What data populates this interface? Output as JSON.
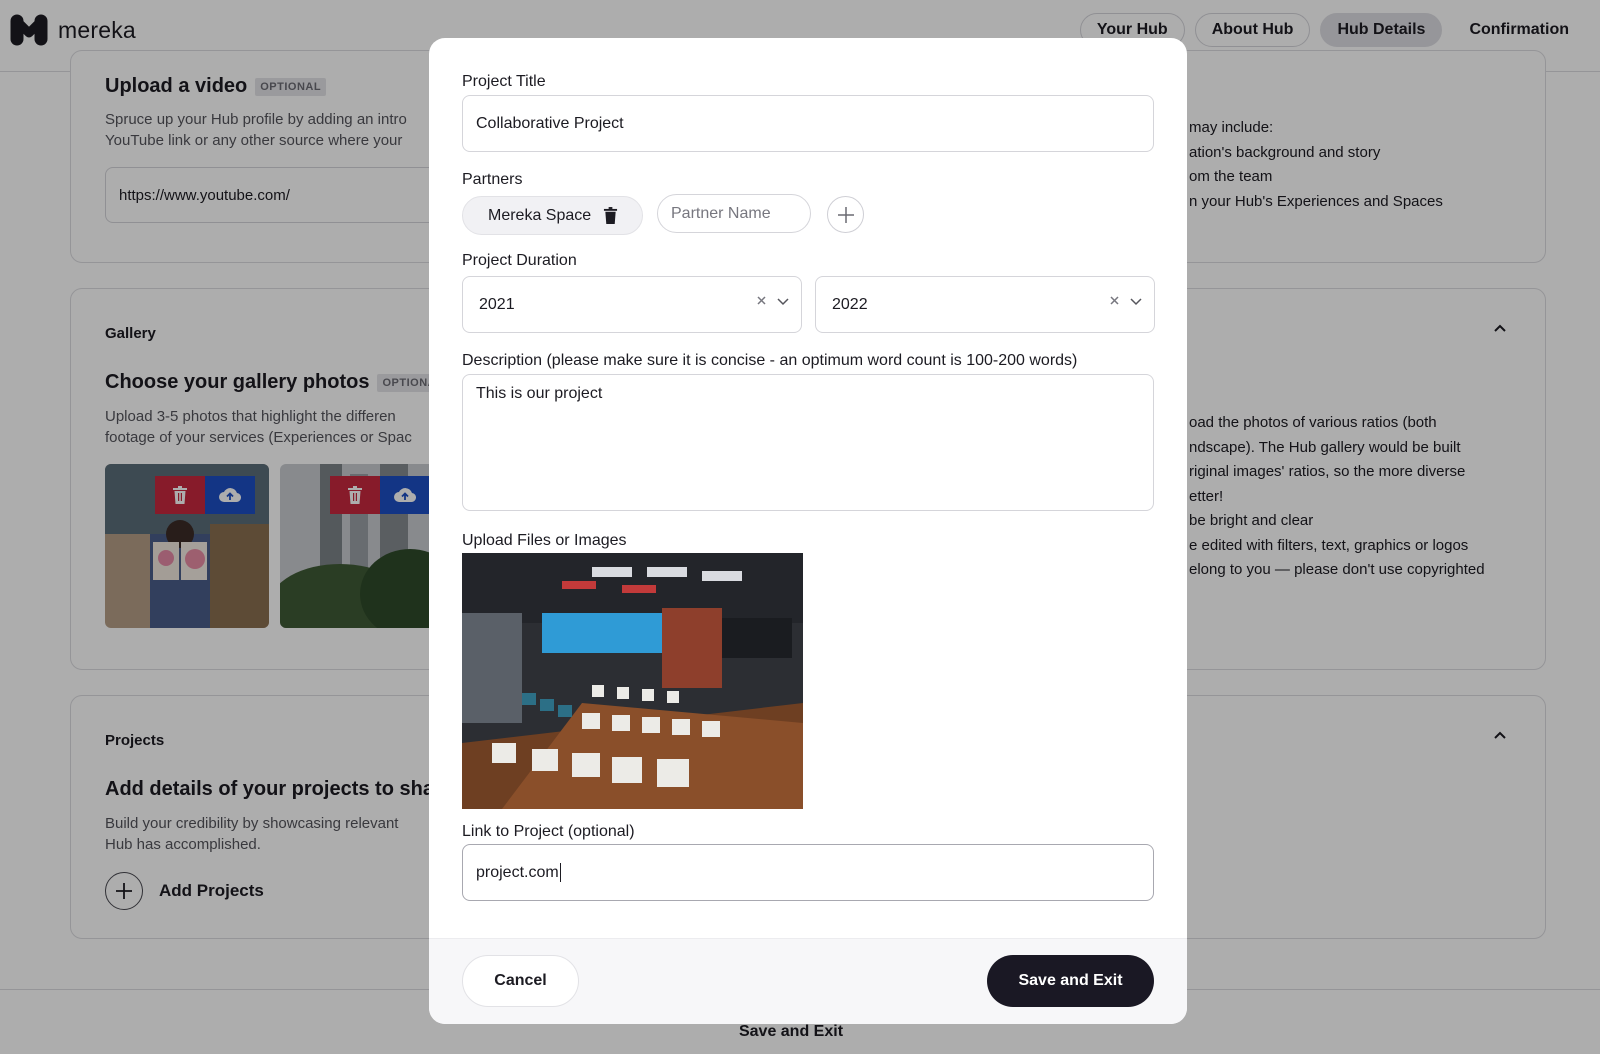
{
  "app": {
    "brand": "mereka"
  },
  "steps": [
    {
      "label": "Your Hub"
    },
    {
      "label": "About Hub"
    },
    {
      "label": "Hub Details"
    },
    {
      "label": "Confirmation"
    }
  ],
  "video_section": {
    "heading": "Upload a video",
    "badge": "OPTIONAL",
    "desc_line1": "Spruce up your Hub profile by adding an intro",
    "desc_line2": "YouTube link or any other source where your",
    "url_value": "https://www.youtube.com/",
    "right_list": [
      "may include:",
      "ation's background and story",
      "om the team",
      "n your Hub's Experiences and Spaces"
    ]
  },
  "gallery_section": {
    "label": "Gallery",
    "heading": "Choose your gallery photos",
    "badge": "OPTIONA",
    "desc_line1": "Upload 3-5 photos that highlight the differen",
    "desc_line2": "footage of your services (Experiences or Spac",
    "right_list": [
      "oad the photos of various ratios (both",
      "ndscape). The Hub gallery would be built",
      "riginal images' ratios, so the more diverse",
      "etter!",
      "be bright and clear",
      "e edited with filters, text, graphics or logos",
      "elong to you — please don't use copyrighted"
    ]
  },
  "projects_section": {
    "label": "Projects",
    "heading": "Add details of your projects to shar",
    "desc_line1": "Build your credibility by showcasing relevant",
    "desc_line2": "Hub has accomplished.",
    "add_label": "Add Projects"
  },
  "bottom": {
    "save_label": "Save and Exit"
  },
  "modal": {
    "title_label": "Project Title",
    "title_value": "Collaborative Project",
    "partners_label": "Partners",
    "partner_chip": "Mereka Space",
    "partner_placeholder": "Partner Name",
    "duration_label": "Project Duration",
    "start_year": "2021",
    "end_year": "2022",
    "description_label": "Description (please make sure it is concise - an optimum word count is 100-200 words)",
    "description_value": "This is our project",
    "upload_label": "Upload Files or Images",
    "link_label": "Link to Project (optional)",
    "link_value": "project.com",
    "cancel_label": "Cancel",
    "save_label": "Save and Exit"
  },
  "colors": {
    "delete_red": "#c8283e",
    "upload_blue": "#1d4fc4",
    "primary_dark": "#1a1824"
  }
}
